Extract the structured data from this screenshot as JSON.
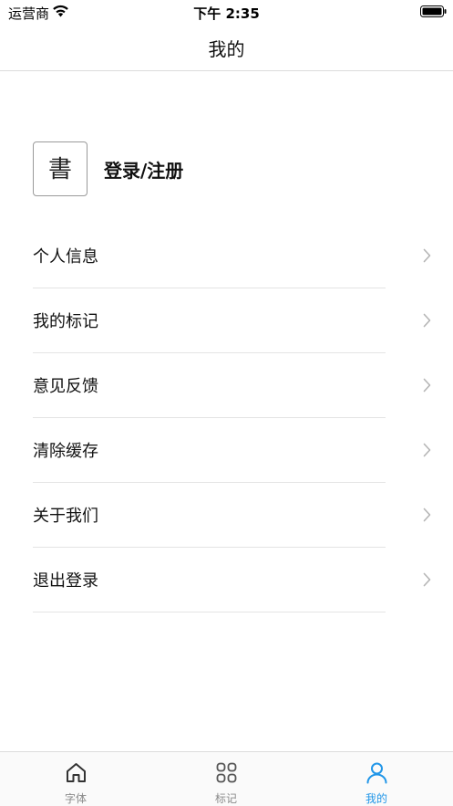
{
  "status_bar": {
    "carrier": "运营商",
    "time": "下午 2:35"
  },
  "nav": {
    "title": "我的"
  },
  "profile": {
    "login_label": "登录/注册",
    "avatar_glyph": "書"
  },
  "menu": {
    "items": [
      {
        "label": "个人信息"
      },
      {
        "label": "我的标记"
      },
      {
        "label": "意见反馈"
      },
      {
        "label": "清除缓存"
      },
      {
        "label": "关于我们"
      },
      {
        "label": "退出登录"
      }
    ]
  },
  "tab_bar": {
    "tabs": [
      {
        "label": "字体",
        "icon": "home-icon",
        "active": false
      },
      {
        "label": "标记",
        "icon": "grid-icon",
        "active": false
      },
      {
        "label": "我的",
        "icon": "person-icon",
        "active": true
      }
    ],
    "active_color": "#2196e8",
    "inactive_color": "#8a8a8a"
  }
}
